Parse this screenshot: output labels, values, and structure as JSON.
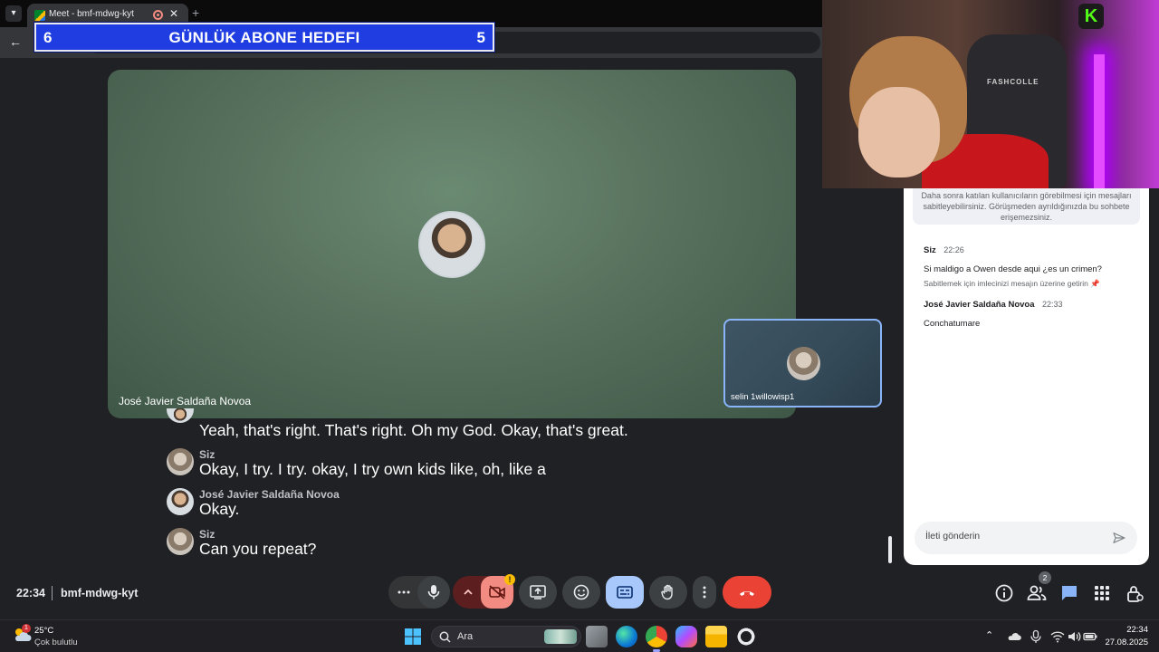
{
  "browser": {
    "tab_title": "Meet - bmf-mdwg-kyt",
    "tab_close": "✕",
    "new_tab": "+",
    "back": "←"
  },
  "overlay": {
    "left_count": "6",
    "title": "GÜNLÜK ABONE HEDEFI",
    "right_count": "5",
    "webcam_chair_brand": "FASHCOLLE",
    "kick_logo": "K"
  },
  "meet": {
    "main_participant": "José Javier Saldaña Novoa",
    "self_participant": "selin 1willowisp1",
    "time": "22:34",
    "meeting_code": "bmf-mdwg-kyt",
    "camera_warning": "!",
    "people_count": "2"
  },
  "captions": [
    {
      "speaker": "",
      "text": "Yeah, that's right. That's right. Oh my God. Okay, that's great."
    },
    {
      "speaker": "Siz",
      "text": "Okay, I try. I try. okay, I try own kids like, oh, like a"
    },
    {
      "speaker": "José Javier Saldaña Novoa",
      "text": "Okay."
    },
    {
      "speaker": "Siz",
      "text": "Can you repeat?"
    }
  ],
  "chat": {
    "notice": "Daha sonra katılan kullanıcıların görebilmesi için mesajları sabitleyebilirsiniz. Görüşmeden ayrıldığınızda bu sohbete erişemezsiniz.",
    "messages": [
      {
        "sender": "Siz",
        "time": "22:26",
        "body": "Si maldigo a Owen desde aqui ¿es un crimen?",
        "hint": "Sabitlemek için imlecinizi mesajın üzerine getirin"
      },
      {
        "sender": "José Javier Saldaña Novoa",
        "time": "22:33",
        "body": "Conchatumare"
      }
    ],
    "input_placeholder": "İleti gönderin"
  },
  "taskbar": {
    "weather_temp": "25°C",
    "weather_desc": "Çok bulutlu",
    "weather_badge": "1",
    "search_label": "Ara",
    "clock_time": "22:34",
    "clock_date": "27.08.2025"
  },
  "colors": {
    "banner_blue": "#1f3de0",
    "end_call_red": "#ea4335",
    "active_blue": "#a8c7fa",
    "camera_off": "#f28b82"
  }
}
